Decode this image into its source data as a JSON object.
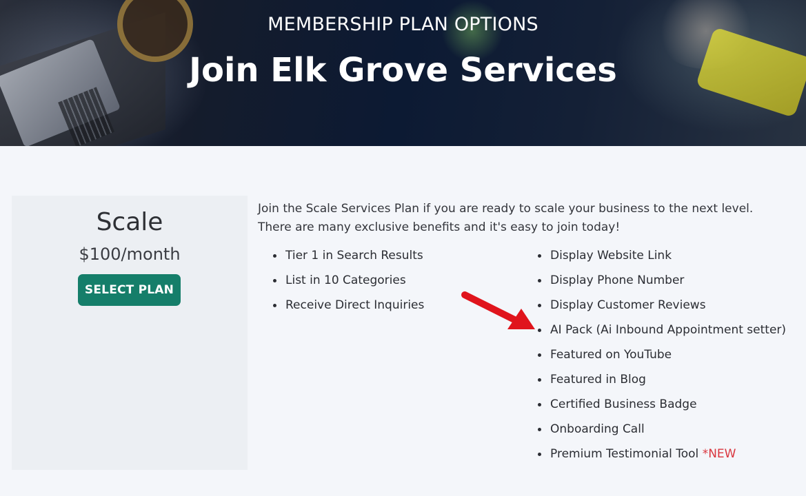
{
  "hero": {
    "eyebrow": "MEMBERSHIP PLAN OPTIONS",
    "title": "Join Elk Grove Services"
  },
  "plan": {
    "name": "Scale",
    "price": "$100/month",
    "button_label": "SELECT PLAN"
  },
  "description": {
    "line1": "Join the Scale Services Plan if you are ready to scale your business to the next level.",
    "line2": "There are many exclusive benefits and it's easy to join today!"
  },
  "benefits_left": [
    "Tier 1 in Search Results",
    "List in 10 Categories",
    "Receive Direct Inquiries"
  ],
  "benefits_right": [
    "Display Website Link",
    "Display Phone Number",
    "Display Customer Reviews",
    "AI Pack (Ai Inbound Appointment setter)",
    "Featured on YouTube",
    "Featured in Blog",
    "Certified Business Badge",
    "Onboarding Call",
    "Premium Testimonial Tool "
  ],
  "new_tag": "*NEW",
  "colors": {
    "accent": "#157e6a",
    "new_tag": "#d9363e",
    "arrow": "#e0141c",
    "card_bg": "#eceff3",
    "page_bg": "#f4f6fa"
  },
  "icons": {
    "annotation": "red-arrow-icon"
  }
}
